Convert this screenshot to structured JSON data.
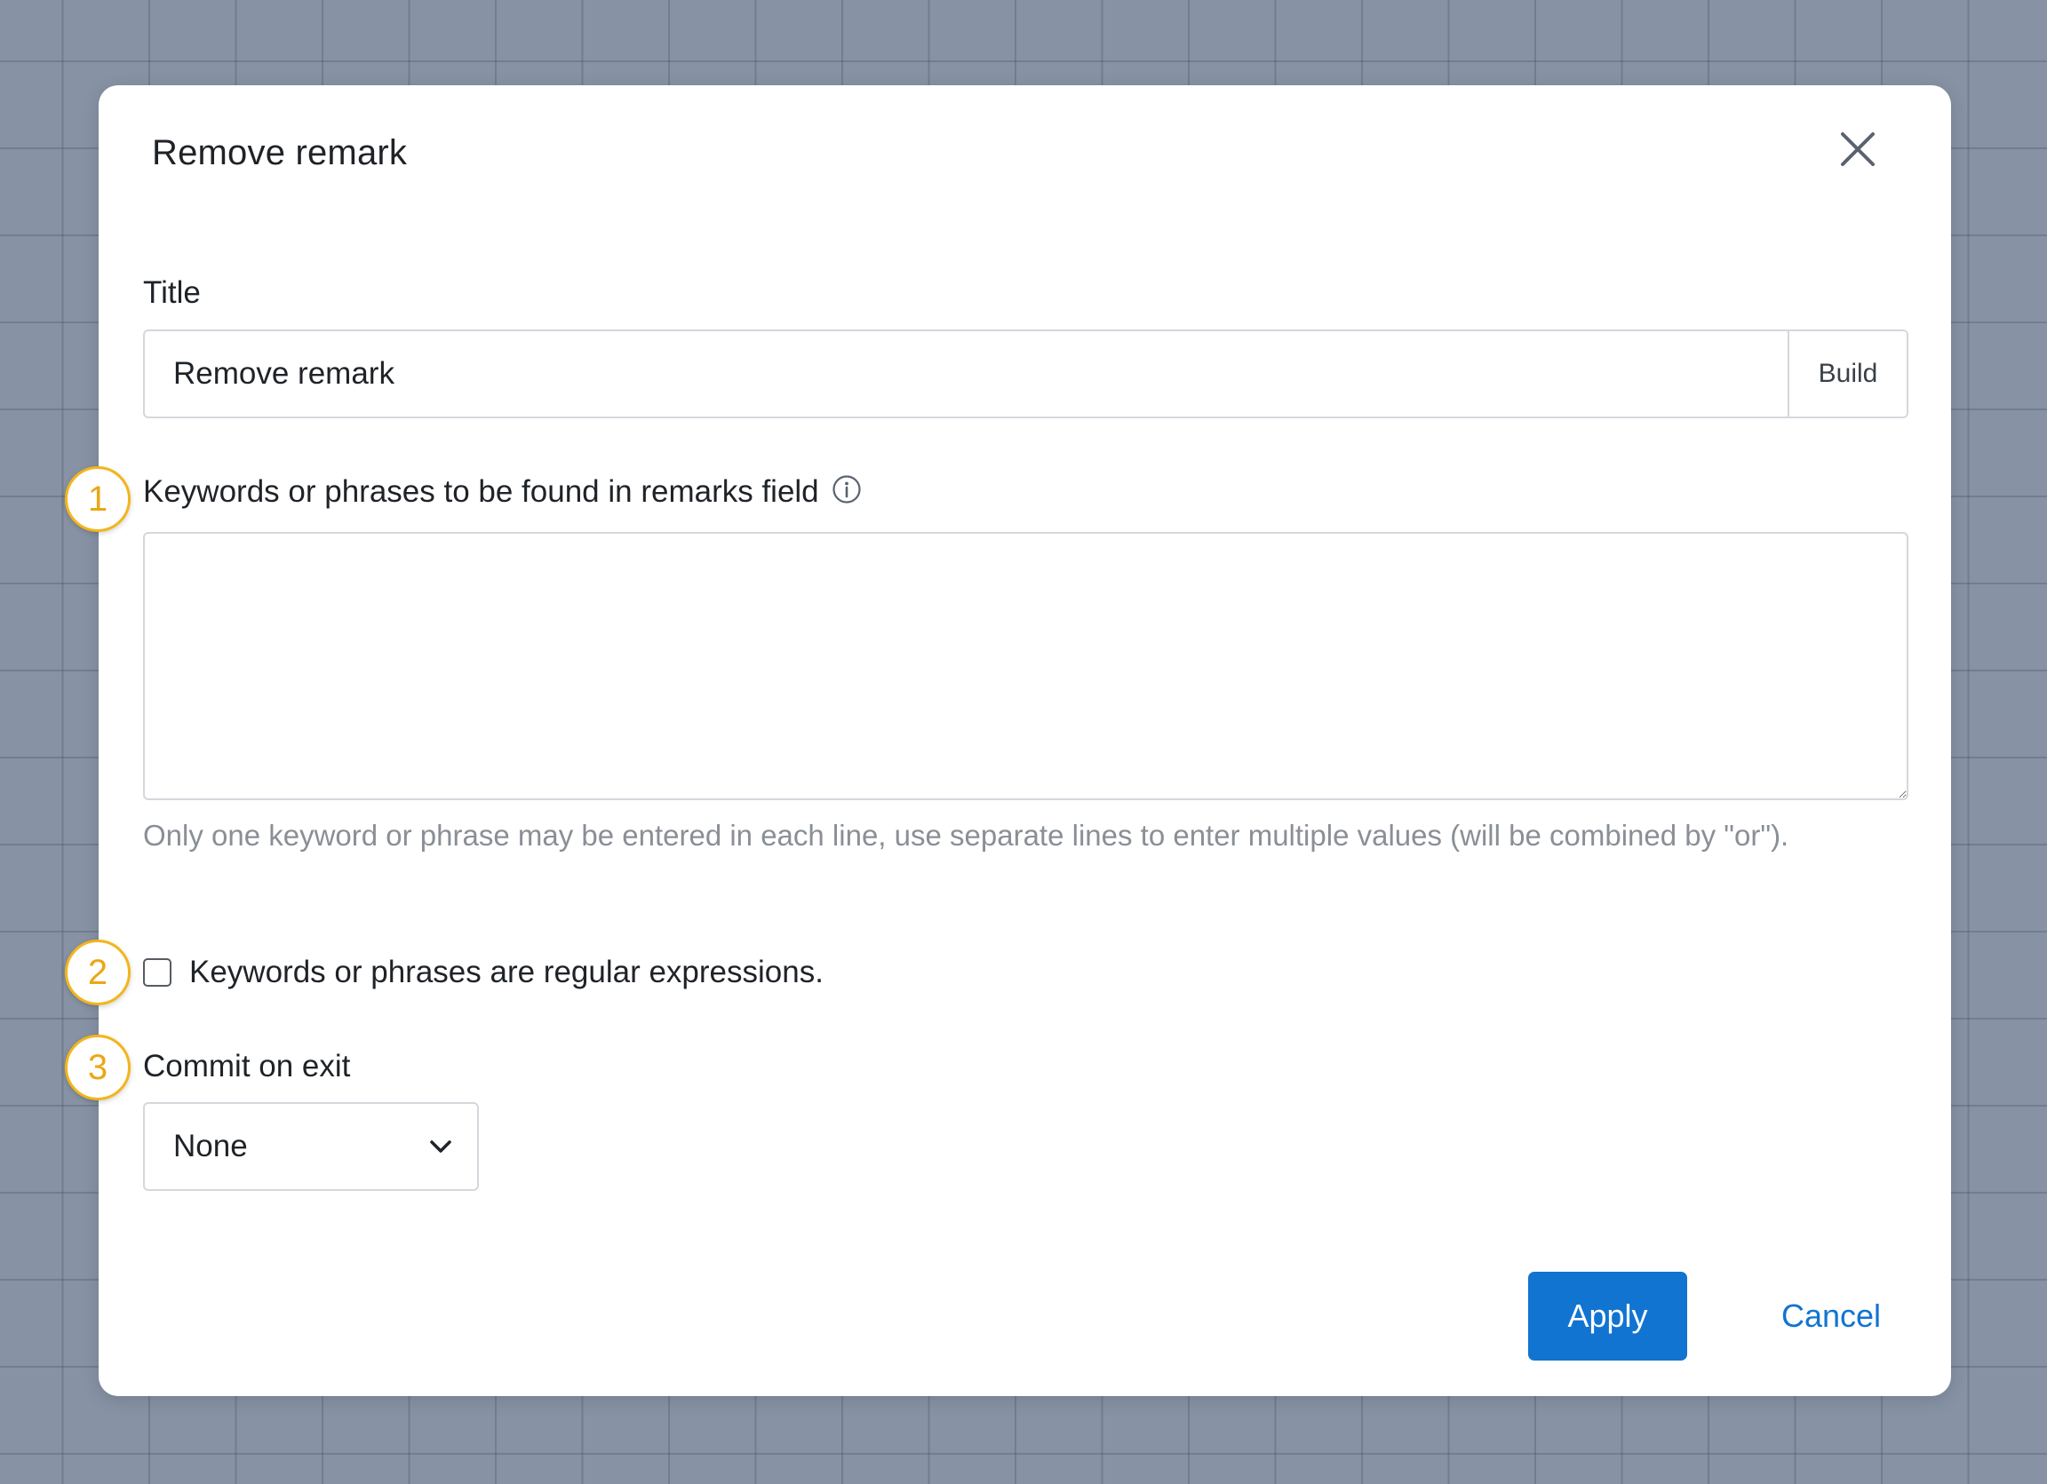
{
  "dialog": {
    "title": "Remove remark",
    "close_icon": "close-icon"
  },
  "title_field": {
    "label": "Title",
    "value": "Remove remark",
    "build_label": "Build"
  },
  "keywords_field": {
    "label": "Keywords or phrases to be found in remarks field",
    "info_icon": "info-icon",
    "value": "",
    "help_text": "Only one keyword or phrase may be entered in each line, use separate lines to enter multiple values (will be combined by \"or\")."
  },
  "regex_option": {
    "label": "Keywords or phrases are regular expressions.",
    "checked": false
  },
  "commit_field": {
    "label": "Commit on exit",
    "selected": "None",
    "chevron_icon": "chevron-down-icon"
  },
  "actions": {
    "apply_label": "Apply",
    "cancel_label": "Cancel"
  },
  "step_badges": [
    "1",
    "2",
    "3"
  ],
  "colors": {
    "primary": "#1174d1",
    "badge": "#f2b51b",
    "backdrop": "#8793a4"
  }
}
